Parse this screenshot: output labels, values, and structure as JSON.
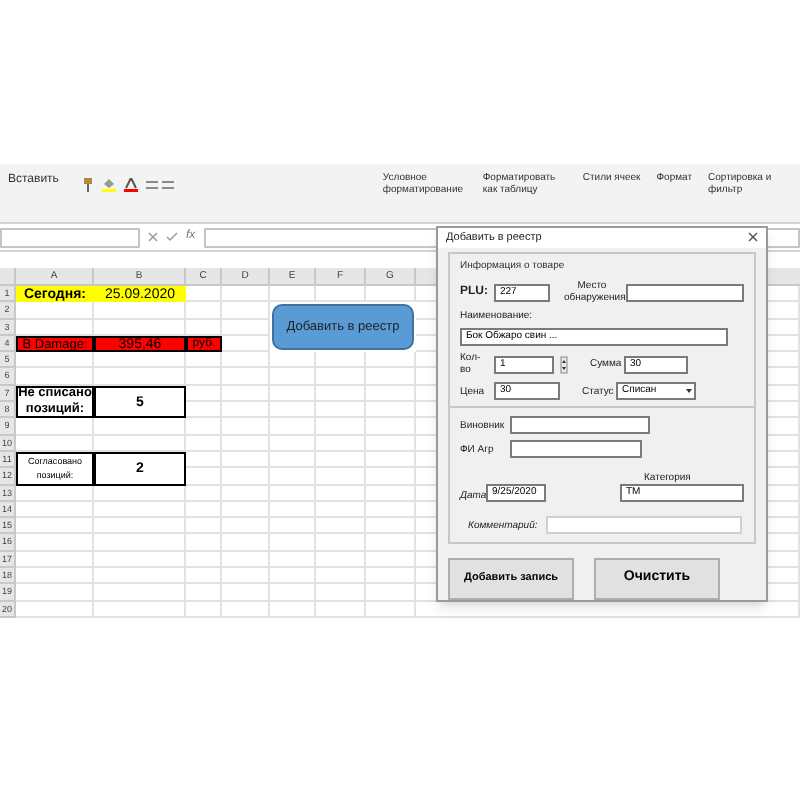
{
  "ribbon": {
    "paste": "Вставить",
    "groups": [
      "Условное форматирование",
      "Форматировать как таблицу",
      "Стили ячеек",
      "Формат",
      "Сортировка и фильтр"
    ]
  },
  "formula_bar": {
    "fx": "fx"
  },
  "sheet": {
    "columns": [
      "A",
      "B",
      "C",
      "D",
      "E",
      "F",
      "G"
    ],
    "rows": [
      "1",
      "2",
      "3",
      "4",
      "5",
      "6",
      "7",
      "8",
      "9",
      "10",
      "11",
      "12",
      "13",
      "14",
      "15",
      "16",
      "17",
      "18",
      "19",
      "20"
    ],
    "today": {
      "label": "Сегодня:",
      "value": "25.09.2020"
    },
    "damage": {
      "label": "В Damage:",
      "value": "395,46",
      "unit": "руб."
    },
    "not_written_off": {
      "label": "Не списано позиций:",
      "value": "5"
    },
    "approved": {
      "label": "Согласовано позиций:",
      "value": "2"
    },
    "shape_button": "Добавить в реестр"
  },
  "dialog": {
    "title": "Добавить в реестр",
    "product_info": {
      "legend": "Информация о товаре",
      "plu": {
        "label": "PLU:",
        "value": "227"
      },
      "location": {
        "label": "Место обнаружения"
      },
      "name": {
        "label": "Наименование:",
        "value": "Бок Обжаро свин ..."
      },
      "qty": {
        "label": "Кол-во",
        "value": "1"
      },
      "sum": {
        "label": "Сумма",
        "value": "30"
      },
      "price": {
        "label": "Цена",
        "value": "30"
      },
      "status": {
        "label": "Статус",
        "value": "Списан"
      }
    },
    "culprit": {
      "label": "Виновник"
    },
    "fio": {
      "label": "ФИ Агр"
    },
    "date": {
      "label": "Дата",
      "value": "9/25/2020"
    },
    "category": {
      "label": "Категория",
      "value": "ТМ"
    },
    "comment": {
      "label": "Комментарий:"
    },
    "buttons": [
      "Добавить запись",
      "Очистить"
    ]
  }
}
